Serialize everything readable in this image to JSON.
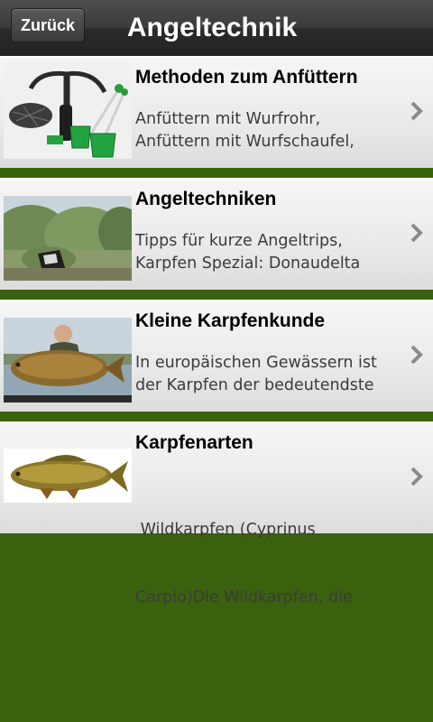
{
  "header": {
    "back_label": "Zurück",
    "title": "Angeltechnik"
  },
  "items": [
    {
      "title": "Methoden zum Anfüttern",
      "desc_line1": "Anfüttern mit Wurfrohr,",
      "desc_line2": "Anfüttern mit Wurfschaufel,",
      "icon": "feeding-tools-image"
    },
    {
      "title": "Angeltechniken",
      "desc_line1": "Tipps für kurze Angeltrips,",
      "desc_line2": "Karpfen Spezial: Donaudelta",
      "icon": "fishing-spot-image"
    },
    {
      "title": "Kleine Karpfenkunde",
      "desc_line1": "In europäischen Gewässern ist",
      "desc_line2": "der Karpfen der bedeutendste",
      "icon": "angler-with-carp-image"
    },
    {
      "title": "Karpfenarten",
      "desc_line1": " Wildkarpfen (Cyprinus",
      "desc_line2": "Carpio)Die Wildkarpfen, die",
      "icon": "carp-fish-image"
    }
  ],
  "colors": {
    "background": "#3a610e",
    "header": "#2f2f2f",
    "chevron": "#8a8a8a"
  }
}
